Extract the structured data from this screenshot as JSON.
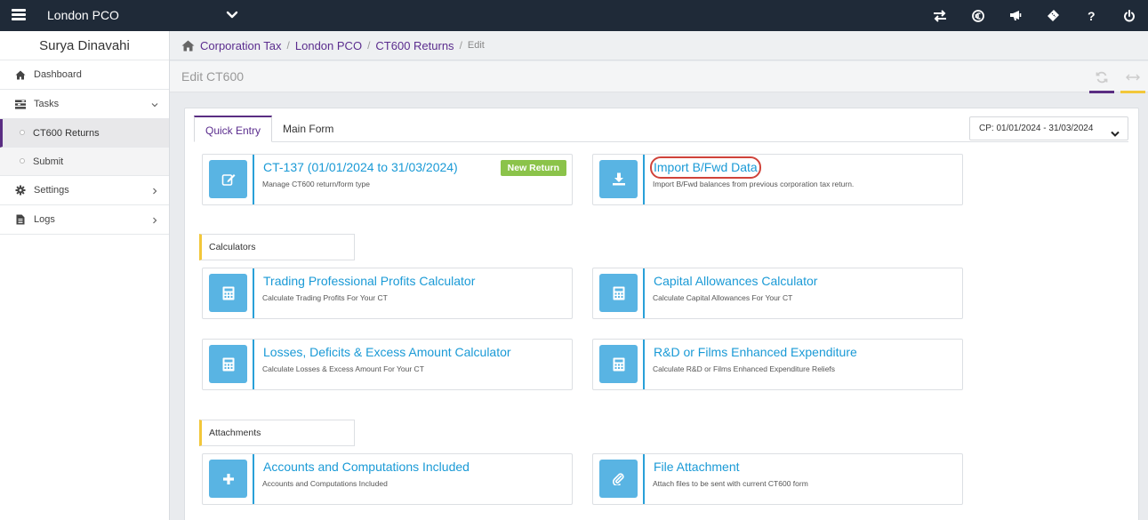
{
  "topbar": {
    "company": "London PCO",
    "icons": [
      "transfer-icon",
      "currency-icon",
      "megaphone-icon",
      "ticket-icon",
      "help-icon",
      "power-icon"
    ],
    "help_label": "?"
  },
  "sidebar": {
    "user": "Surya Dinavahi",
    "items": [
      {
        "label": "Dashboard",
        "icon": "home-icon"
      },
      {
        "label": "Tasks",
        "icon": "tasks-icon"
      },
      {
        "label": "CT600 Returns"
      },
      {
        "label": "Submit"
      },
      {
        "label": "Settings",
        "icon": "gear-icon"
      },
      {
        "label": "Logs",
        "icon": "document-icon"
      }
    ]
  },
  "breadcrumb": {
    "items": [
      "Corporation Tax",
      "London PCO",
      "CT600 Returns"
    ],
    "current": "Edit"
  },
  "page": {
    "title": "Edit CT600"
  },
  "tabs": [
    "Quick Entry",
    "Main Form"
  ],
  "period": "CP: 01/01/2024 - 31/03/2024",
  "cards": {
    "ct137": {
      "title": "CT-137 (01/01/2024 to 31/03/2024)",
      "subtitle": "Manage CT600 return/form type",
      "badge": "New Return"
    },
    "import": {
      "title": "Import B/Fwd Data",
      "subtitle": "Import B/Fwd balances from previous corporation tax return."
    },
    "trading": {
      "title": "Trading Professional Profits Calculator",
      "subtitle": "Calculate Trading Profits For Your CT"
    },
    "capital": {
      "title": "Capital Allowances Calculator",
      "subtitle": "Calculate Capital Allowances For Your CT"
    },
    "losses": {
      "title": "Losses, Deficits & Excess Amount Calculator",
      "subtitle": "Calculate Losses & Excess Amount For Your CT"
    },
    "rnd": {
      "title": "R&D or Films Enhanced Expenditure",
      "subtitle": "Calculate R&D or Films Enhanced Expenditure Reliefs"
    },
    "accounts": {
      "title": "Accounts and Computations Included",
      "subtitle": "Accounts and Computations Included"
    },
    "file": {
      "title": "File Attachment",
      "subtitle": "Attach files to be sent with current CT600 form"
    }
  },
  "sections": {
    "calculators": "Calculators",
    "attachments": "Attachments"
  },
  "colors": {
    "topbar": "#1f2a38",
    "accent_purple": "#5a2d82",
    "link_blue": "#1a9ad6",
    "icon_blue": "#59b4e3",
    "badge_green": "#8bc34a",
    "section_yellow": "#f2c73a",
    "highlight_red": "#d0433a"
  }
}
